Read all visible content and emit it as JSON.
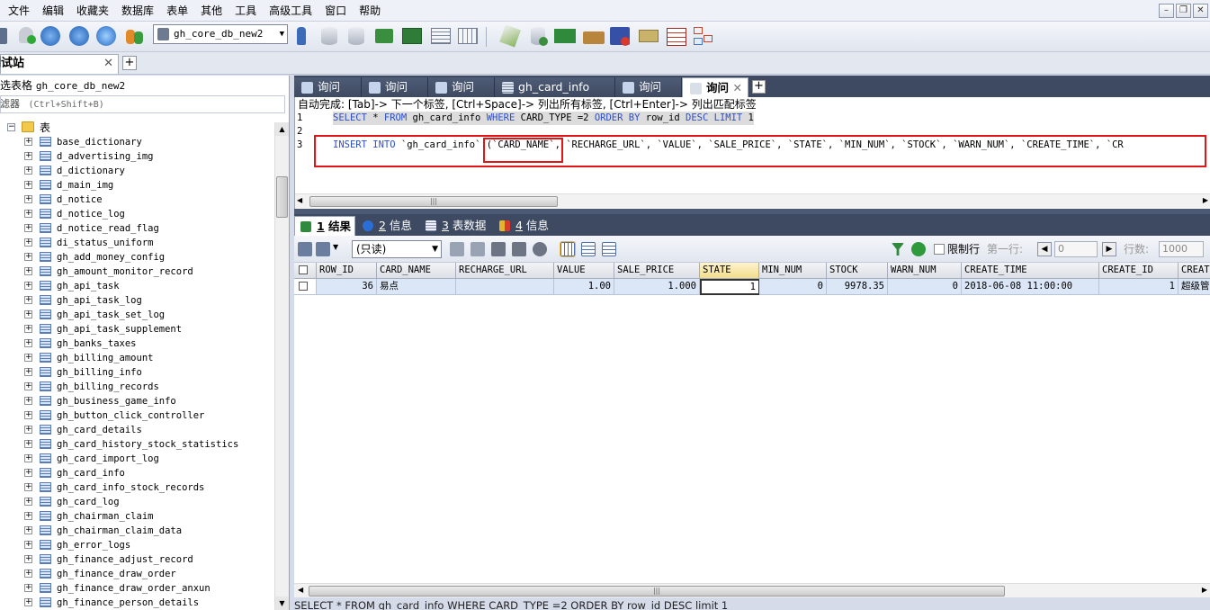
{
  "menubar": {
    "items": [
      "文件",
      "编辑",
      "收藏夹",
      "数据库",
      "表单",
      "其他",
      "工具",
      "高级工具",
      "窗口",
      "帮助"
    ],
    "window_controls": {
      "minimize": "–",
      "restore": "❐",
      "close": "✕"
    }
  },
  "toolbar": {
    "database_selected": "gh_core_db_new2"
  },
  "connection": {
    "tab_label": "测试站",
    "close": "✕",
    "add": "+"
  },
  "left_panel": {
    "header_label": "已选表格",
    "header_db": "gh_core_db_new2",
    "filter_label": "过滤器",
    "filter_placeholder": "(Ctrl+Shift+B)",
    "root_label": "表",
    "tables": [
      "base_dictionary",
      "d_advertising_img",
      "d_dictionary",
      "d_main_img",
      "d_notice",
      "d_notice_log",
      "d_notice_read_flag",
      "di_status_uniform",
      "gh_add_money_config",
      "gh_amount_monitor_record",
      "gh_api_task",
      "gh_api_task_log",
      "gh_api_task_set_log",
      "gh_api_task_supplement",
      "gh_banks_taxes",
      "gh_billing_amount",
      "gh_billing_info",
      "gh_billing_records",
      "gh_business_game_info",
      "gh_button_click_controller",
      "gh_card_details",
      "gh_card_history_stock_statistics",
      "gh_card_import_log",
      "gh_card_info",
      "gh_card_info_stock_records",
      "gh_card_log",
      "gh_chairman_claim",
      "gh_chairman_claim_data",
      "gh_error_logs",
      "gh_finance_adjust_record",
      "gh_finance_draw_order",
      "gh_finance_draw_order_anxun",
      "gh_finance_person_details"
    ]
  },
  "query_tabs": [
    {
      "label": "询问",
      "active": false
    },
    {
      "label": "询问",
      "active": false
    },
    {
      "label": "询问",
      "active": false
    },
    {
      "label": "gh_card_info",
      "active": false
    },
    {
      "label": "询问",
      "active": false
    },
    {
      "label": "询问",
      "active": true
    }
  ],
  "editor": {
    "autocomplete_hint": "自动完成: [Tab]-> 下一个标签, [Ctrl+Space]-> 列出所有标签, [Ctrl+Enter]-> 列出匹配标签",
    "line_numbers": [
      "1",
      "2",
      "3"
    ],
    "line1": {
      "k1": "SELECT",
      "t1": " * ",
      "k2": "FROM",
      "t2": " gh_card_info ",
      "k3": "WHERE",
      "t3": "   CARD_TYPE =2 ",
      "k4": "ORDER BY",
      "t4": " row_id ",
      "k5": "DESC",
      "t5": " ",
      "k6": "LIMIT",
      "t6": " 1"
    },
    "line3": {
      "k1": "INSERT",
      "t1": " ",
      "k2": "INTO",
      "t2": " `gh_card_info` (`CARD_NAME`, `RECHARGE_URL`, `VALUE`, `SALE_PRICE`, `STATE`, `MIN_NUM`, `STOCK`, `WARN_NUM`, `CREATE_TIME`, `CR"
    },
    "scroll_grip": "|||"
  },
  "result_tabs": [
    {
      "num": "1",
      "label": " 结果"
    },
    {
      "num": "2",
      "label": " 信息"
    },
    {
      "num": "3",
      "label": " 表数据"
    },
    {
      "num": "4",
      "label": " 信息"
    }
  ],
  "result_toolbar": {
    "readonly": "(只读)",
    "limit_label": "限制行",
    "first_row_label": "第一行:",
    "first_row_value": "0",
    "row_count_label": "行数:",
    "row_count_value": "1000"
  },
  "grid": {
    "columns": [
      "ROW_ID",
      "CARD_NAME",
      "RECHARGE_URL",
      "VALUE",
      "SALE_PRICE",
      "STATE",
      "MIN_NUM",
      "STOCK",
      "WARN_NUM",
      "CREATE_TIME",
      "CREATE_ID",
      "CREAT"
    ],
    "row": [
      "36",
      "易点",
      "",
      "1.00",
      "1.000",
      "1",
      "0",
      "9978.35",
      "0",
      "2018-06-08 11:00:00",
      "1",
      "超级管"
    ]
  },
  "statusbar": {
    "text": "SELECT * FROM gh_card_info WHERE CARD_TYPE =2 ORDER BY row_id DESC limit 1"
  },
  "colors": {
    "tab_bar": "#3e4a61",
    "keyword": "#2c4fc9",
    "highlight_box": "#e01515",
    "row_bg": "#dbe6f7"
  }
}
